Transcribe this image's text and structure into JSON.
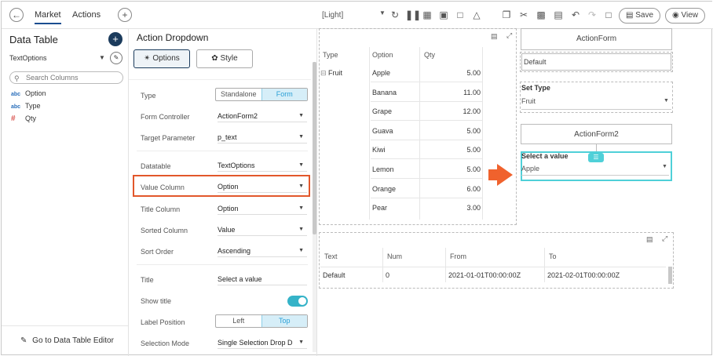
{
  "topbar": {
    "tabs": [
      "Market",
      "Actions"
    ],
    "theme": "[Light]",
    "save_label": "Save",
    "view_label": "View"
  },
  "left": {
    "title": "Data Table",
    "datasource": "TextOptions",
    "search_placeholder": "Search Columns",
    "columns": [
      {
        "kind": "abc",
        "name": "Option"
      },
      {
        "kind": "abc",
        "name": "Type"
      },
      {
        "kind": "#",
        "name": "Qty"
      }
    ],
    "goto_label": "Go to Data Table Editor"
  },
  "mid": {
    "title": "Action Dropdown",
    "tabs": [
      "Options",
      "Style"
    ],
    "props": {
      "type_label": "Type",
      "type_options": [
        "Standalone",
        "Form"
      ],
      "form_controller_label": "Form Controller",
      "form_controller_value": "ActionForm2",
      "target_param_label": "Target Parameter",
      "target_param_value": "p_text",
      "datatable_label": "Datatable",
      "datatable_value": "TextOptions",
      "value_column_label": "Value Column",
      "value_column_value": "Option",
      "title_column_label": "Title Column",
      "title_column_value": "Option",
      "sorted_column_label": "Sorted Column",
      "sorted_column_value": "Value",
      "sort_order_label": "Sort Order",
      "sort_order_value": "Ascending",
      "title_label": "Title",
      "title_value": "Select a value",
      "show_title_label": "Show title",
      "label_position_label": "Label Position",
      "label_position_options": [
        "Left",
        "Top"
      ],
      "selection_mode_label": "Selection Mode",
      "selection_mode_value": "Single Selection Drop D"
    }
  },
  "canvas": {
    "table1": {
      "headers": [
        "Type",
        "Option",
        "Qty"
      ],
      "group": "Fruit",
      "rows": [
        [
          "Apple",
          "5.00"
        ],
        [
          "Banana",
          "11.00"
        ],
        [
          "Grape",
          "12.00"
        ],
        [
          "Guava",
          "5.00"
        ],
        [
          "Kiwi",
          "5.00"
        ],
        [
          "Lemon",
          "5.00"
        ],
        [
          "Orange",
          "6.00"
        ],
        [
          "Pear",
          "3.00"
        ]
      ]
    },
    "form1": {
      "title": "ActionForm",
      "default_value": "Default",
      "set_type_label": "Set Type",
      "set_type_value": "Fruit"
    },
    "form2": {
      "title": "ActionForm2",
      "select_label": "Select a value",
      "select_value": "Apple"
    },
    "table2": {
      "headers": [
        "Text",
        "Num",
        "From",
        "To"
      ],
      "row": [
        "Default",
        "0",
        "2021-01-01T00:00:00Z",
        "2021-02-01T00:00:00Z"
      ]
    }
  },
  "colors": {
    "accent_dark": "#1b3b5c",
    "highlight": "#e2572b",
    "teal": "#35b3c8",
    "arrow": "#f0622d"
  }
}
